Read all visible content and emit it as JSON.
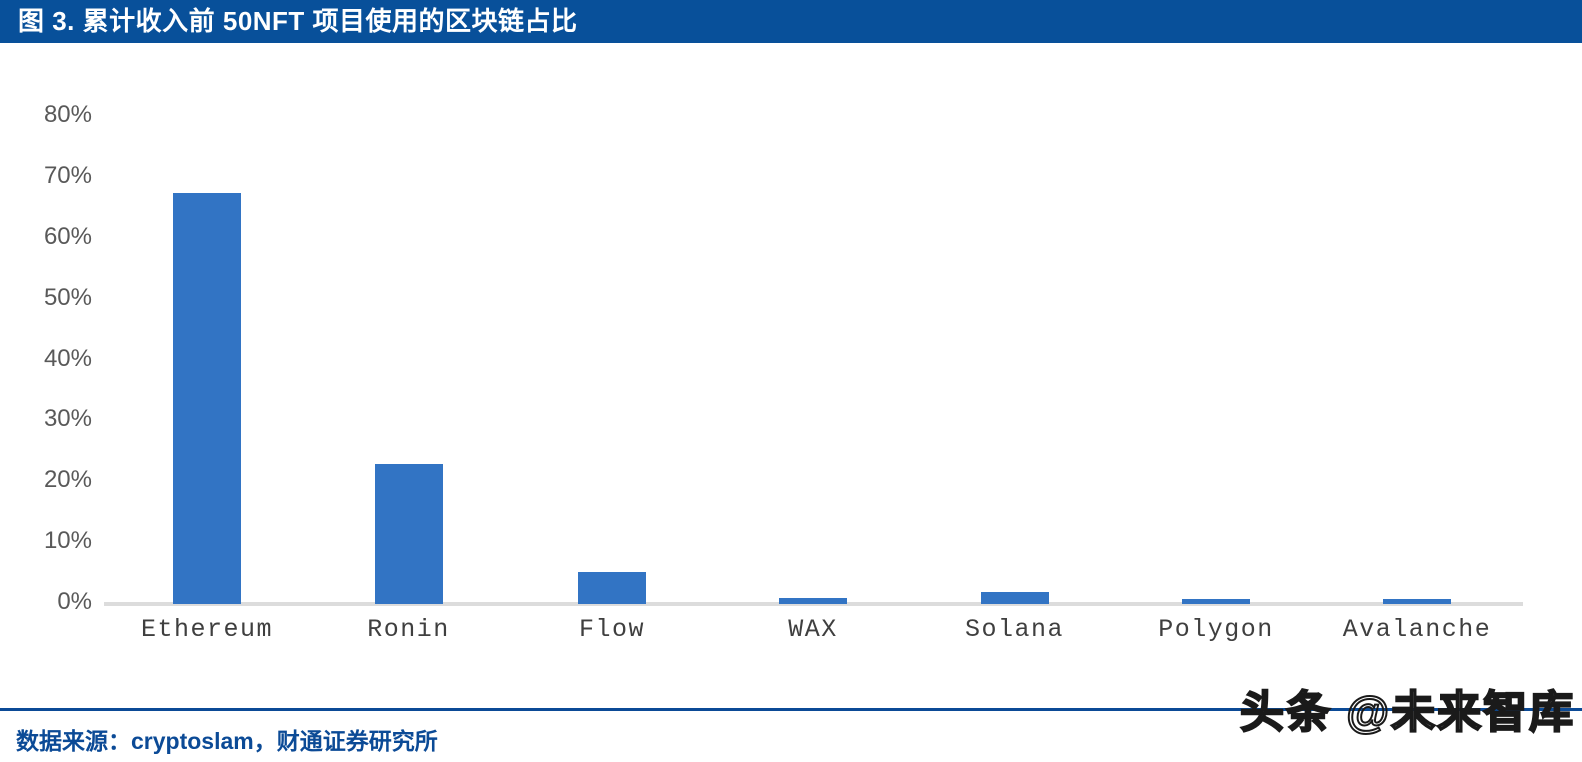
{
  "header": {
    "title": "图 3. 累计收入前 50NFT 项目使用的区块链占比",
    "background_color": "#08509A",
    "text_color": "#FFFFFF"
  },
  "footer": {
    "source_text": "数据来源：cryptoslam，财通证券研究所",
    "rule_color": "#0B4A96",
    "text_color": "#0B4A96"
  },
  "watermark": {
    "text": "头条 @未来智库"
  },
  "chart_data": {
    "type": "bar",
    "title": "图 3. 累计收入前 50NFT 项目使用的区块链占比",
    "xlabel": "",
    "ylabel": "",
    "categories": [
      "Ethereum",
      "Ronin",
      "Flow",
      "WAX",
      "Solana",
      "Polygon",
      "Avalanche"
    ],
    "values": [
      67.5,
      23.0,
      5.2,
      1.0,
      2.0,
      0.8,
      0.8
    ],
    "value_unit": "%",
    "ylim": [
      0,
      80
    ],
    "ytick_values": [
      0,
      10,
      20,
      30,
      40,
      50,
      60,
      70,
      80
    ],
    "ytick_labels": [
      "0%",
      "10%",
      "20%",
      "30%",
      "40%",
      "50%",
      "60%",
      "70%",
      "80%"
    ],
    "grid": false,
    "legend": false,
    "bar_color": "#3274C4",
    "axis_line_color": "#DCDCDC",
    "ytick_label_color": "#595959",
    "xtick_label_color": "#3F3F3F"
  }
}
